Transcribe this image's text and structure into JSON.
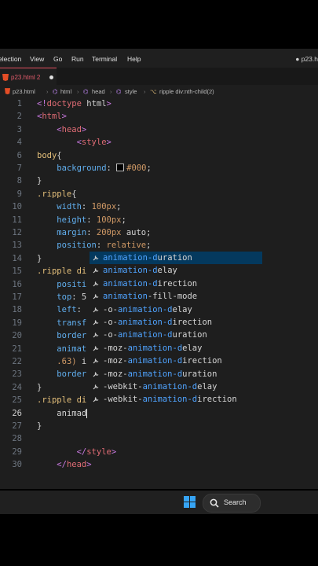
{
  "menu": {
    "items": [
      "election",
      "View",
      "Go",
      "Run",
      "Terminal",
      "Help"
    ],
    "window_title": "p23.h"
  },
  "tab": {
    "label": "p23.html 2"
  },
  "breadcrumb": [
    "p23.html",
    "html",
    "head",
    "style",
    "ripple div:nth-child(2)"
  ],
  "editor": {
    "lines": [
      {
        "n": "1",
        "t": [
          [
            "p",
            "<!"
          ],
          [
            "tg",
            "doctype"
          ],
          [
            "pl",
            " html"
          ],
          [
            "p",
            ">"
          ]
        ]
      },
      {
        "n": "2",
        "t": [
          [
            "p",
            "<"
          ],
          [
            "tg",
            "html"
          ],
          [
            "p",
            ">"
          ]
        ]
      },
      {
        "n": "3",
        "t": [
          [
            "pl",
            "    "
          ],
          [
            "p",
            "<"
          ],
          [
            "tg",
            "head"
          ],
          [
            "p",
            ">"
          ]
        ]
      },
      {
        "n": "4",
        "t": [
          [
            "pl",
            "        "
          ],
          [
            "p",
            "<"
          ],
          [
            "tg",
            "style"
          ],
          [
            "p",
            ">"
          ]
        ]
      },
      {
        "n": "6",
        "t": [
          [
            "s",
            "body"
          ],
          [
            "pl",
            "{"
          ]
        ]
      },
      {
        "n": "7",
        "t": [
          [
            "pl",
            "    "
          ],
          [
            "pr",
            "background"
          ],
          [
            "pl",
            ": "
          ],
          [
            "sw",
            ""
          ],
          [
            "v",
            "#000"
          ],
          [
            "pl",
            ";"
          ]
        ]
      },
      {
        "n": "8",
        "t": [
          [
            "pl",
            "}"
          ]
        ]
      },
      {
        "n": "9",
        "t": [
          [
            "s",
            ".ripple"
          ],
          [
            "pl",
            "{"
          ]
        ]
      },
      {
        "n": "10",
        "t": [
          [
            "pl",
            "    "
          ],
          [
            "pr",
            "width"
          ],
          [
            "pl",
            ": "
          ],
          [
            "v",
            "100px"
          ],
          [
            "pl",
            ";"
          ]
        ]
      },
      {
        "n": "11",
        "t": [
          [
            "pl",
            "    "
          ],
          [
            "pr",
            "height"
          ],
          [
            "pl",
            ": "
          ],
          [
            "v",
            "100px"
          ],
          [
            "pl",
            ";"
          ]
        ]
      },
      {
        "n": "12",
        "t": [
          [
            "pl",
            "    "
          ],
          [
            "pr",
            "margin"
          ],
          [
            "pl",
            ": "
          ],
          [
            "v",
            "200px"
          ],
          [
            "pl",
            " auto;"
          ]
        ]
      },
      {
        "n": "13",
        "t": [
          [
            "pl",
            "    "
          ],
          [
            "pr",
            "position"
          ],
          [
            "pl",
            ": "
          ],
          [
            "v",
            "relative"
          ],
          [
            "pl",
            ";"
          ]
        ]
      },
      {
        "n": "14",
        "t": [
          [
            "pl",
            "}"
          ]
        ]
      },
      {
        "n": "15",
        "t": [
          [
            "s",
            ".ripple di"
          ]
        ]
      },
      {
        "n": "16",
        "t": [
          [
            "pl",
            "    "
          ],
          [
            "pr",
            "positi"
          ]
        ]
      },
      {
        "n": "17",
        "t": [
          [
            "pl",
            "    "
          ],
          [
            "pr",
            "top"
          ],
          [
            "pl",
            ": 5"
          ]
        ]
      },
      {
        "n": "18",
        "t": [
          [
            "pl",
            "    "
          ],
          [
            "pr",
            "left"
          ],
          [
            "pl",
            ":"
          ]
        ]
      },
      {
        "n": "19",
        "t": [
          [
            "pl",
            "    "
          ],
          [
            "pr",
            "transf"
          ]
        ]
      },
      {
        "n": "20",
        "t": [
          [
            "pl",
            "    "
          ],
          [
            "pr",
            "border"
          ]
        ]
      },
      {
        "n": "21",
        "t": [
          [
            "pl",
            "    "
          ],
          [
            "pr",
            "animat"
          ]
        ]
      },
      {
        "n": "22",
        "t": [
          [
            "pl",
            "    "
          ],
          [
            "v",
            ".63)"
          ],
          [
            "pl",
            " i"
          ]
        ]
      },
      {
        "n": "23",
        "t": [
          [
            "pl",
            "    "
          ],
          [
            "pr",
            "border"
          ]
        ]
      },
      {
        "n": "24",
        "t": [
          [
            "pl",
            "}"
          ]
        ]
      },
      {
        "n": "25",
        "t": [
          [
            "s",
            ".ripple di"
          ]
        ]
      },
      {
        "n": "26",
        "t": [
          [
            "pl",
            "    "
          ],
          [
            "pl",
            "animad"
          ],
          [
            "c",
            ""
          ]
        ]
      },
      {
        "n": "27",
        "t": [
          [
            "pl",
            "}"
          ]
        ]
      },
      {
        "n": "28",
        "t": []
      },
      {
        "n": "29",
        "t": [
          [
            "pl",
            "        "
          ],
          [
            "p",
            "</"
          ],
          [
            "tg",
            "style"
          ],
          [
            "p",
            ">"
          ]
        ]
      },
      {
        "n": "30",
        "t": [
          [
            "pl",
            "    "
          ],
          [
            "p",
            "</"
          ],
          [
            "tg",
            "head"
          ],
          [
            "p",
            ">"
          ]
        ]
      }
    ]
  },
  "suggestions": [
    {
      "pre": "",
      "m": "animation-d",
      "post": "uration",
      "selected": true
    },
    {
      "pre": "",
      "m": "animation-d",
      "post": "elay",
      "selected": false
    },
    {
      "pre": "",
      "m": "animation-d",
      "post": "irection",
      "selected": false
    },
    {
      "pre": "",
      "m": "animation",
      "post": "-fill-mode",
      "selected": false
    },
    {
      "pre": "-o-",
      "m": "animation-d",
      "post": "elay",
      "selected": false
    },
    {
      "pre": "-o-",
      "m": "animation-d",
      "post": "irection",
      "selected": false
    },
    {
      "pre": "-o-",
      "m": "animation-d",
      "post": "uration",
      "selected": false
    },
    {
      "pre": "-moz-",
      "m": "animation-d",
      "post": "elay",
      "selected": false
    },
    {
      "pre": "-moz-",
      "m": "animation-d",
      "post": "irection",
      "selected": false
    },
    {
      "pre": "-moz-",
      "m": "animation-d",
      "post": "uration",
      "selected": false
    },
    {
      "pre": "-webkit-",
      "m": "animation-d",
      "post": "elay",
      "selected": false
    },
    {
      "pre": "-webkit-",
      "m": "animation-d",
      "post": "irection",
      "selected": false
    }
  ],
  "taskbar": {
    "search_label": "Search"
  },
  "icons": {
    "suggest": "wrench-icon",
    "tab": "html-file-icon",
    "start": "windows-logo-icon",
    "search": "search-icon"
  },
  "colors": {
    "suggest_match": "#4fa3ff",
    "tab_accent": "#e04f5f",
    "selection": "#04395e"
  }
}
